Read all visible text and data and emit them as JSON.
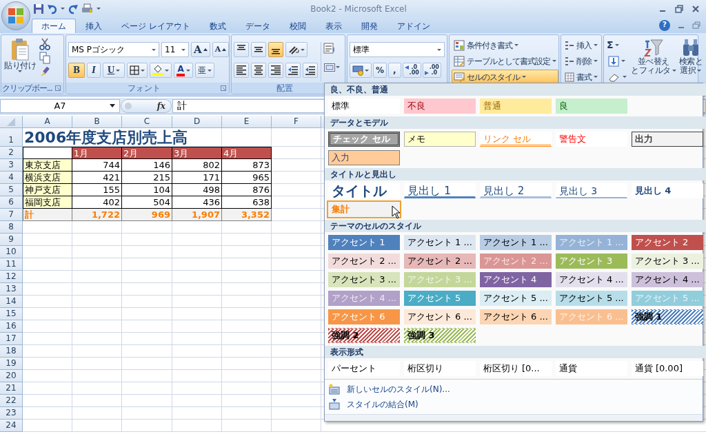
{
  "window": {
    "title": "Book2 - Microsoft Excel"
  },
  "tabs": [
    {
      "label": "ホーム",
      "selected": true
    },
    {
      "label": "挿入",
      "selected": false
    },
    {
      "label": "ページ レイアウト",
      "selected": false
    },
    {
      "label": "数式",
      "selected": false
    },
    {
      "label": "データ",
      "selected": false
    },
    {
      "label": "校閲",
      "selected": false
    },
    {
      "label": "表示",
      "selected": false
    },
    {
      "label": "開発",
      "selected": false
    },
    {
      "label": "アドイン",
      "selected": false
    }
  ],
  "help": "?",
  "ribbon": {
    "clipboard": {
      "label": "クリップボー...",
      "paste": "貼り付け"
    },
    "font": {
      "label": "フォント",
      "name": "MS Pゴシック",
      "size": "11",
      "size_buttons": [
        {
          "kind": "grow",
          "text": "A"
        },
        {
          "kind": "shrink",
          "text": "A"
        }
      ],
      "style_buttons": [
        {
          "kind": "bold",
          "text": "B",
          "on": true
        },
        {
          "kind": "italic",
          "text": "I",
          "on": false
        },
        {
          "kind": "underline",
          "text": "U",
          "on": false
        }
      ],
      "fill": {
        "color": "#ffff00"
      },
      "font_color": {
        "text": "A",
        "color": "#ff0000"
      },
      "phonetic": "亜"
    },
    "alignment": {
      "label": "配置",
      "vertical": [
        {
          "kind": "top",
          "on": false
        },
        {
          "kind": "middle",
          "on": false
        },
        {
          "kind": "bottom",
          "on": true
        }
      ]
    },
    "number": {
      "format": "標準",
      "percent": "%",
      "comma": ",",
      "decimals": [
        {
          "kind": "increase",
          "lines": [
            ".0",
            ".00"
          ]
        },
        {
          "kind": "decrease",
          "lines": [
            ".00",
            ".0"
          ]
        }
      ]
    },
    "styles": {
      "buttons": [
        {
          "text": "条件付き書式",
          "on": false
        },
        {
          "text": "テーブルとして書式設定",
          "on": false
        },
        {
          "text": "セルのスタイル",
          "on": true
        }
      ]
    },
    "cells": {
      "buttons": [
        "挿入",
        "削除",
        "書式"
      ]
    },
    "editing": {
      "sum": "Σ",
      "sort": [
        "並べ替え",
        "とフィルタ"
      ],
      "find": [
        "検索と",
        "選択"
      ]
    }
  },
  "formula_bar": {
    "name_box": "A7",
    "fx": "fx",
    "formula": "計"
  },
  "sheet": {
    "columns": [
      "A",
      "B",
      "C",
      "D",
      "E",
      "F"
    ],
    "rows": [
      {
        "number": "1",
        "kind": "title",
        "label": "2006年度支店別売上高"
      },
      {
        "number": "2",
        "kind": "header",
        "values": [
          "1月",
          "2月",
          "3月",
          "4月"
        ]
      },
      {
        "number": "3",
        "kind": "data",
        "label": "東京支店",
        "values": [
          "744",
          "146",
          "802",
          "873"
        ]
      },
      {
        "number": "4",
        "kind": "data",
        "label": "横浜支店",
        "values": [
          "421",
          "215",
          "171",
          "965"
        ]
      },
      {
        "number": "5",
        "kind": "data",
        "label": "神戸支店",
        "values": [
          "155",
          "104",
          "498",
          "876"
        ]
      },
      {
        "number": "6",
        "kind": "data",
        "label": "福岡支店",
        "values": [
          "402",
          "504",
          "436",
          "638"
        ]
      },
      {
        "number": "7",
        "kind": "total",
        "label": "計",
        "values": [
          "1,722",
          "969",
          "1,907",
          "3,352"
        ]
      },
      {
        "number": "8",
        "kind": "empty"
      },
      {
        "number": "9",
        "kind": "empty"
      },
      {
        "number": "10",
        "kind": "empty"
      },
      {
        "number": "11",
        "kind": "empty"
      },
      {
        "number": "12",
        "kind": "empty"
      },
      {
        "number": "13",
        "kind": "empty"
      },
      {
        "number": "14",
        "kind": "empty"
      },
      {
        "number": "15",
        "kind": "empty"
      },
      {
        "number": "16",
        "kind": "empty"
      },
      {
        "number": "17",
        "kind": "empty"
      },
      {
        "number": "18",
        "kind": "empty"
      },
      {
        "number": "19",
        "kind": "empty"
      },
      {
        "number": "20",
        "kind": "empty"
      },
      {
        "number": "21",
        "kind": "empty"
      },
      {
        "number": "22",
        "kind": "empty"
      },
      {
        "number": "23",
        "kind": "empty"
      },
      {
        "number": "24",
        "kind": "empty"
      }
    ]
  },
  "gallery": {
    "sections": [
      {
        "title": "良、不良、普通",
        "items": [
          {
            "text": "標準",
            "kind": "plain",
            "hovered": false
          },
          {
            "text": "不良",
            "kind": "bad",
            "color": "#ffc7ce",
            "hovered": false
          },
          {
            "text": "普通",
            "kind": "neutral",
            "color": "#ffeb9c",
            "hovered": false
          },
          {
            "text": "良",
            "kind": "good",
            "color": "#c6efce",
            "hovered": false
          }
        ]
      },
      {
        "title": "データとモデル",
        "items": [
          {
            "text": "チェック セル",
            "kind": "check",
            "color": "#a5a5a5",
            "hovered": false
          },
          {
            "text": "メモ",
            "kind": "note",
            "color": "#ffffcc",
            "hovered": false
          },
          {
            "text": "リンク セル",
            "kind": "linked",
            "hovered": false
          },
          {
            "text": "警告文",
            "kind": "warning",
            "hovered": false
          },
          {
            "text": "出力",
            "kind": "output",
            "color": "#f2f2f2",
            "hovered": false
          },
          {
            "text": "入力",
            "kind": "input",
            "color": "#ffcc99",
            "hovered": false
          }
        ]
      },
      {
        "title": "タイトルと見出し",
        "items": [
          {
            "text": "タイトル",
            "kind": "title",
            "hovered": false
          },
          {
            "text": "見出し 1",
            "kind": "heading1",
            "hovered": false
          },
          {
            "text": "見出し 2",
            "kind": "heading2",
            "hovered": false
          },
          {
            "text": "見出し 3",
            "kind": "heading3",
            "hovered": false
          },
          {
            "text": "見出し 4",
            "kind": "heading4",
            "hovered": false
          },
          {
            "text": "集計",
            "kind": "total",
            "color": "#f2f2f2",
            "hovered": true
          }
        ]
      },
      {
        "title": "テーマのセルのスタイル",
        "items": [
          {
            "text": "アクセント 1",
            "kind": "accent",
            "color": "#4f81bd",
            "hovered": false
          },
          {
            "text": "アクセント 1 ...",
            "kind": "accent-light",
            "color": "#dce6f1",
            "hovered": false
          },
          {
            "text": "アクセント 1 ...",
            "kind": "accent-light",
            "color": "#b8cce4",
            "hovered": false
          },
          {
            "text": "アクセント 1 ...",
            "kind": "accent-faded",
            "color": "#95b3d7",
            "hovered": false
          },
          {
            "text": "アクセント 2",
            "kind": "accent",
            "color": "#c0504d",
            "hovered": false
          },
          {
            "text": "アクセント 2 ...",
            "kind": "accent-light",
            "color": "#f2dcdb",
            "hovered": false
          },
          {
            "text": "アクセント 2 ...",
            "kind": "accent-light",
            "color": "#e6b8b7",
            "hovered": false
          },
          {
            "text": "アクセント 2 ...",
            "kind": "accent-faded",
            "color": "#da9694",
            "hovered": false
          },
          {
            "text": "アクセント 3",
            "kind": "accent",
            "color": "#9bbb59",
            "hovered": false
          },
          {
            "text": "アクセント 3 ...",
            "kind": "accent-light",
            "color": "#ebf1de",
            "hovered": false
          },
          {
            "text": "アクセント 3 ...",
            "kind": "accent-light",
            "color": "#d8e4bc",
            "hovered": false
          },
          {
            "text": "アクセント 3 ...",
            "kind": "accent-faded",
            "color": "#c4d79b",
            "hovered": false
          },
          {
            "text": "アクセント 4",
            "kind": "accent",
            "color": "#8064a2",
            "hovered": false
          },
          {
            "text": "アクセント 4 ...",
            "kind": "accent-light",
            "color": "#e4dfec",
            "hovered": false
          },
          {
            "text": "アクセント 4 ...",
            "kind": "accent-light",
            "color": "#ccc0da",
            "hovered": false
          },
          {
            "text": "アクセント 4 ...",
            "kind": "accent-faded",
            "color": "#b1a0c7",
            "hovered": false
          },
          {
            "text": "アクセント 5",
            "kind": "accent",
            "color": "#4bacc6",
            "hovered": false
          },
          {
            "text": "アクセント 5 ...",
            "kind": "accent-light",
            "color": "#daeef3",
            "hovered": false
          },
          {
            "text": "アクセント 5 ...",
            "kind": "accent-light",
            "color": "#b7dee8",
            "hovered": false
          },
          {
            "text": "アクセント 5 ...",
            "kind": "accent-faded",
            "color": "#92cddc",
            "hovered": false
          },
          {
            "text": "アクセント 6",
            "kind": "accent",
            "color": "#f79646",
            "hovered": false
          },
          {
            "text": "アクセント 6 ...",
            "kind": "accent-light",
            "color": "#fde9d9",
            "hovered": false
          },
          {
            "text": "アクセント 6 ...",
            "kind": "accent-light",
            "color": "#fcd5b4",
            "hovered": false
          },
          {
            "text": "アクセント 6 ...",
            "kind": "accent-faded",
            "color": "#fabf8f",
            "hovered": false
          },
          {
            "text": "強調 1",
            "kind": "hatch",
            "color": "#4f81bd",
            "hovered": false
          },
          {
            "text": "強調 2",
            "kind": "hatch",
            "color": "#c0504d",
            "hovered": false
          },
          {
            "text": "強調 3",
            "kind": "hatch",
            "color": "#9bbb59",
            "hovered": false
          }
        ]
      },
      {
        "title": "表示形式",
        "items": [
          {
            "text": "パーセント",
            "kind": "plain",
            "hovered": false
          },
          {
            "text": "桁区切り",
            "kind": "plain",
            "hovered": false
          },
          {
            "text": "桁区切り [0...",
            "kind": "plain",
            "hovered": false
          },
          {
            "text": "通貨",
            "kind": "plain",
            "hovered": false
          },
          {
            "text": "通貨 [0.00]",
            "kind": "plain",
            "hovered": false
          }
        ]
      }
    ],
    "menu": [
      {
        "kind": "new",
        "text": "新しいセルのスタイル(N)..."
      },
      {
        "kind": "merge",
        "text": "スタイルの結合(M)"
      }
    ]
  }
}
